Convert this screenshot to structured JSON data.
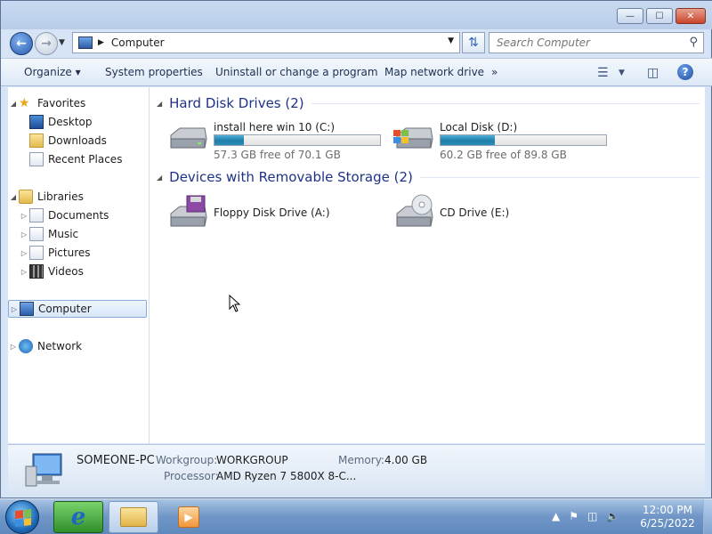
{
  "window": {
    "controls": {
      "minimize": "—",
      "maximize": "☐",
      "close": "✕"
    }
  },
  "address": {
    "location": "Computer",
    "search_placeholder": "Search Computer"
  },
  "toolbar": {
    "organize": "Organize ▾",
    "system_properties": "System properties",
    "uninstall": "Uninstall or change a program",
    "map_network_drive": "Map network drive",
    "more": "»",
    "help": "?"
  },
  "sidebar": {
    "favorites": {
      "label": "Favorites",
      "items": [
        "Desktop",
        "Downloads",
        "Recent Places"
      ]
    },
    "libraries": {
      "label": "Libraries",
      "items": [
        "Documents",
        "Music",
        "Pictures",
        "Videos"
      ]
    },
    "computer": "Computer",
    "network": "Network"
  },
  "groups": [
    {
      "title": "Hard Disk Drives (2)",
      "drives": [
        {
          "name": "install here win 10 (C:)",
          "free": "57.3 GB free of 70.1 GB",
          "used_fraction": 0.18
        },
        {
          "name": "Local Disk (D:)",
          "free": "60.2 GB free of 89.8 GB",
          "used_fraction": 0.33
        }
      ]
    },
    {
      "title": "Devices with Removable Storage (2)",
      "drives": [
        {
          "name": "Floppy Disk Drive (A:)"
        },
        {
          "name": "CD Drive (E:)"
        }
      ]
    }
  ],
  "details": {
    "computer_name": "SOMEONE-PC",
    "workgroup_label": "Workgroup:",
    "workgroup": "WORKGROUP",
    "memory_label": "Memory:",
    "memory": "4.00 GB",
    "processor_label": "Processor:",
    "processor": "AMD Ryzen 7 5800X 8-C..."
  },
  "taskbar": {
    "time": "12:00 PM",
    "date": "6/25/2022"
  },
  "colors": {
    "accent": "#1e3287",
    "bar_fill": "#2a90bb"
  }
}
